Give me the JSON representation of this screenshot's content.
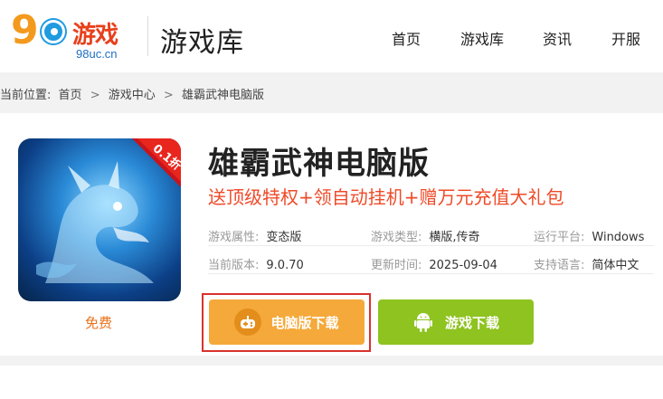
{
  "header": {
    "logo": {
      "brand_text": "游戏",
      "domain": "98uc.cn",
      "number": "9"
    },
    "section_title": "游戏库",
    "nav": [
      "首页",
      "游戏库",
      "资讯",
      "开服"
    ]
  },
  "breadcrumb": {
    "prefix": "当前位置:",
    "items": [
      "首页",
      "游戏中心",
      "雄霸武神电脑版"
    ],
    "separator": ">"
  },
  "game": {
    "title": "雄霸武神电脑版",
    "promo": "送顶级特权+领自动挂机+赠万元充值大礼包",
    "price": "免费",
    "badge": "0.1折",
    "info": [
      {
        "label": "游戏属性:",
        "value": "变态版"
      },
      {
        "label": "游戏类型:",
        "value": "横版,传奇"
      },
      {
        "label": "运行平台:",
        "value": "Windows"
      },
      {
        "label": "当前版本:",
        "value": "9.0.70"
      },
      {
        "label": "更新时间:",
        "value": "2025-09-04"
      },
      {
        "label": "支持语言:",
        "value": "简体中文"
      }
    ]
  },
  "buttons": {
    "pc_download": "电脑版下载",
    "game_download": "游戏下载"
  },
  "colors": {
    "pc_button": "#f5a93a",
    "game_button": "#8ec320",
    "promo": "#ef4a28",
    "highlight_frame": "#d9322c"
  }
}
